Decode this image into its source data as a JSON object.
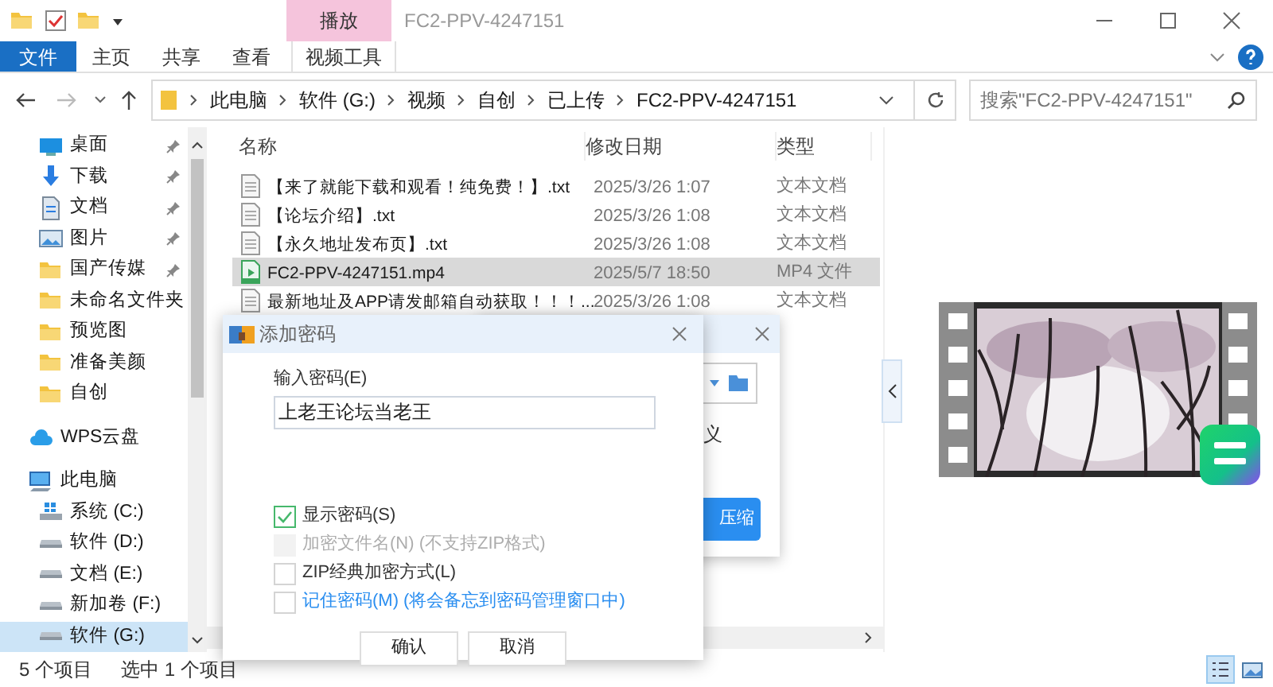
{
  "title_bar": {
    "title": "FC2-PPV-4247151",
    "context_tab": "播放"
  },
  "ribbon_tabs": [
    {
      "label": "文件",
      "kind": "file"
    },
    {
      "label": "主页",
      "kind": "tab"
    },
    {
      "label": "共享",
      "kind": "tab"
    },
    {
      "label": "查看",
      "kind": "tab"
    },
    {
      "label": "视频工具",
      "kind": "context"
    }
  ],
  "address": {
    "path": [
      "此电脑",
      "软件 (G:)",
      "视频",
      "自创",
      "已上传",
      "FC2-PPV-4247151"
    ]
  },
  "search": {
    "placeholder": "搜索\"FC2-PPV-4247151\""
  },
  "nav_items": [
    {
      "label": "桌面",
      "kind": "desktop",
      "pinned": true,
      "selected": false
    },
    {
      "label": "下载",
      "kind": "download",
      "pinned": true,
      "selected": false
    },
    {
      "label": "文档",
      "kind": "document",
      "pinned": true,
      "selected": false
    },
    {
      "label": "图片",
      "kind": "pictures",
      "pinned": true,
      "selected": false
    },
    {
      "label": "国产传媒",
      "kind": "folder",
      "pinned": true,
      "selected": false
    },
    {
      "label": "未命名文件夹",
      "kind": "folder",
      "pinned": false,
      "selected": false
    },
    {
      "label": "预览图",
      "kind": "folder",
      "pinned": false,
      "selected": false
    },
    {
      "label": "准备美颜",
      "kind": "folder",
      "pinned": false,
      "selected": false
    },
    {
      "label": "自创",
      "kind": "folder",
      "pinned": false,
      "selected": false
    },
    {
      "label": "WPS云盘",
      "kind": "cloud",
      "pinned": false,
      "selected": false
    },
    {
      "label": "此电脑",
      "kind": "pc",
      "pinned": false,
      "selected": false,
      "children": [
        {
          "label": "系统 (C:)",
          "kind": "system",
          "pinned": false,
          "selected": false
        },
        {
          "label": "软件 (D:)",
          "kind": "drive",
          "pinned": false,
          "selected": false
        },
        {
          "label": "文档 (E:)",
          "kind": "drive",
          "pinned": false,
          "selected": false
        },
        {
          "label": "新加卷 (F:)",
          "kind": "drive",
          "pinned": false,
          "selected": false
        },
        {
          "label": "软件 (G:)",
          "kind": "drive",
          "pinned": false,
          "selected": true
        }
      ]
    }
  ],
  "columns": [
    "名称",
    "修改日期",
    "类型"
  ],
  "files": [
    {
      "name": "【来了就能下载和观看！纯免费！】.txt",
      "date": "2025/3/26 1:07",
      "type": "文本文档",
      "kind": "text",
      "selected": false
    },
    {
      "name": "【论坛介绍】.txt",
      "date": "2025/3/26 1:08",
      "type": "文本文档",
      "kind": "text",
      "selected": false
    },
    {
      "name": "【永久地址发布页】.txt",
      "date": "2025/3/26 1:08",
      "type": "文本文档",
      "kind": "text",
      "selected": false
    },
    {
      "name": "FC2-PPV-4247151.mp4",
      "date": "2025/5/7 18:50",
      "type": "MP4 文件",
      "kind": "video",
      "selected": true
    },
    {
      "name": "最新地址及APP请发邮箱自动获取！！！...",
      "date": "2025/3/26 1:08",
      "type": "文本文档",
      "kind": "text",
      "selected": false
    }
  ],
  "preview": {
    "kind": "picture"
  },
  "back_dialog": {
    "fragment": "义",
    "button": "压缩"
  },
  "dialog": {
    "title": "添加密码",
    "password_label": "输入密码(E)",
    "password": "上老王论坛当老王",
    "options": [
      {
        "label": "显示密码(S)",
        "checked": true,
        "disabled": false,
        "kind": "plain"
      },
      {
        "label": "加密文件名(N) (不支持ZIP格式)",
        "checked": false,
        "disabled": true,
        "kind": "plain"
      },
      {
        "label": "ZIP经典加密方式(L)",
        "checked": false,
        "disabled": false,
        "kind": "plain"
      },
      {
        "label": "记住密码(M) (将会备忘到密码管理窗口中)",
        "checked": false,
        "disabled": false,
        "kind": "accent"
      }
    ],
    "buttons": [
      "确认",
      "取消"
    ]
  },
  "status_bar": {
    "count": "5 个项目",
    "selection": "选中 1 个项目"
  }
}
